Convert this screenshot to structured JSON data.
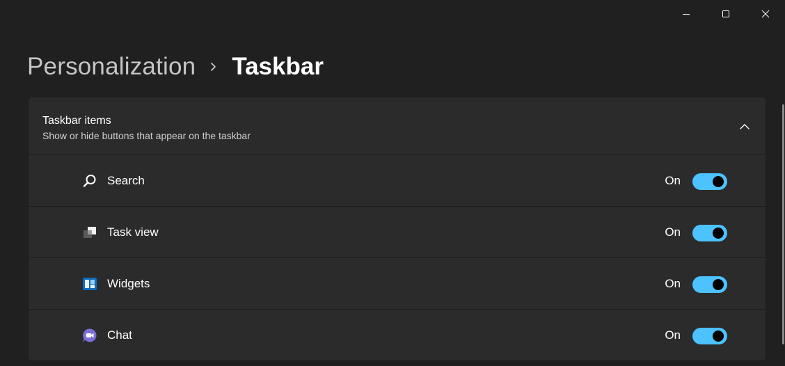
{
  "window": {
    "controls": {
      "minimize": "minimize-icon",
      "maximize": "maximize-icon",
      "close": "close-icon"
    }
  },
  "breadcrumb": {
    "parent": "Personalization",
    "separator_icon": "chevron-right-icon",
    "current": "Taskbar"
  },
  "card": {
    "title": "Taskbar items",
    "subtitle": "Show or hide buttons that appear on the taskbar",
    "expanded": true,
    "collapse_icon": "chevron-up-icon",
    "items": [
      {
        "label": "Search",
        "icon": "search-icon",
        "state": "On",
        "enabled": true
      },
      {
        "label": "Task view",
        "icon": "task-view-icon",
        "state": "On",
        "enabled": true
      },
      {
        "label": "Widgets",
        "icon": "widgets-icon",
        "state": "On",
        "enabled": true
      },
      {
        "label": "Chat",
        "icon": "chat-icon",
        "state": "On",
        "enabled": true
      }
    ]
  },
  "colors": {
    "background": "#202020",
    "card": "#2b2b2b",
    "accent": "#4cc2ff",
    "text": "#ffffff",
    "secondary_text": "#cfcfcf"
  }
}
